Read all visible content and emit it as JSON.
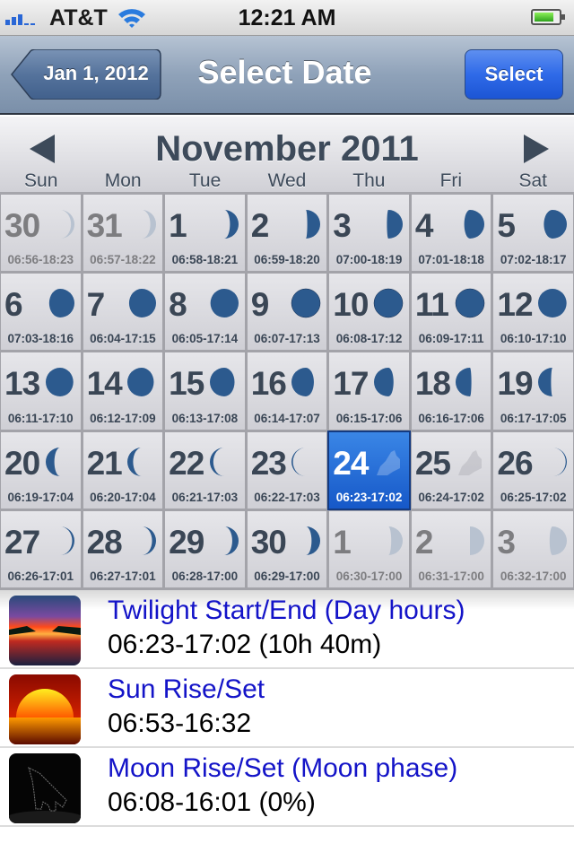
{
  "status_bar": {
    "carrier": "AT&T",
    "time": "12:21 AM",
    "signal_bars": 3,
    "battery_level": 0.7
  },
  "nav": {
    "back_label": "Jan 1, 2012",
    "title": "Select Date",
    "select_label": "Select"
  },
  "calendar": {
    "month_title": "November 2011",
    "weekdays": [
      "Sun",
      "Mon",
      "Tue",
      "Wed",
      "Thu",
      "Fri",
      "Sat"
    ],
    "selected_day": "24",
    "days": [
      {
        "day": "30",
        "times": "06:56-18:23",
        "in_month": false,
        "moon": 0.12,
        "waxing": true
      },
      {
        "day": "31",
        "times": "06:57-18:22",
        "in_month": false,
        "moon": 0.2,
        "waxing": true
      },
      {
        "day": "1",
        "times": "06:58-18:21",
        "in_month": true,
        "moon": 0.3,
        "waxing": true
      },
      {
        "day": "2",
        "times": "06:59-18:20",
        "in_month": true,
        "moon": 0.45,
        "waxing": true
      },
      {
        "day": "3",
        "times": "07:00-18:19",
        "in_month": true,
        "moon": 0.55,
        "waxing": true
      },
      {
        "day": "4",
        "times": "07:01-18:18",
        "in_month": true,
        "moon": 0.7,
        "waxing": true
      },
      {
        "day": "5",
        "times": "07:02-18:17",
        "in_month": true,
        "moon": 0.8,
        "waxing": true
      },
      {
        "day": "6",
        "times": "07:03-18:16",
        "in_month": true,
        "moon": 0.88,
        "waxing": true
      },
      {
        "day": "7",
        "times": "06:04-17:15",
        "in_month": true,
        "moon": 0.94,
        "waxing": true
      },
      {
        "day": "8",
        "times": "06:05-17:14",
        "in_month": true,
        "moon": 0.98,
        "waxing": true
      },
      {
        "day": "9",
        "times": "06:07-17:13",
        "in_month": true,
        "moon": 1.0,
        "waxing": true
      },
      {
        "day": "10",
        "times": "06:08-17:12",
        "in_month": true,
        "moon": 1.0,
        "waxing": true
      },
      {
        "day": "11",
        "times": "06:09-17:11",
        "in_month": true,
        "moon": 1.0,
        "waxing": false
      },
      {
        "day": "12",
        "times": "06:10-17:10",
        "in_month": true,
        "moon": 0.99,
        "waxing": false
      },
      {
        "day": "13",
        "times": "06:11-17:10",
        "in_month": true,
        "moon": 0.96,
        "waxing": false
      },
      {
        "day": "14",
        "times": "06:12-17:09",
        "in_month": true,
        "moon": 0.92,
        "waxing": false
      },
      {
        "day": "15",
        "times": "06:13-17:08",
        "in_month": true,
        "moon": 0.86,
        "waxing": false
      },
      {
        "day": "16",
        "times": "06:14-17:07",
        "in_month": true,
        "moon": 0.78,
        "waxing": false
      },
      {
        "day": "17",
        "times": "06:15-17:06",
        "in_month": true,
        "moon": 0.68,
        "waxing": false
      },
      {
        "day": "18",
        "times": "06:16-17:06",
        "in_month": true,
        "moon": 0.55,
        "waxing": false
      },
      {
        "day": "19",
        "times": "06:17-17:05",
        "in_month": true,
        "moon": 0.45,
        "waxing": false
      },
      {
        "day": "20",
        "times": "06:19-17:04",
        "in_month": true,
        "moon": 0.3,
        "waxing": false
      },
      {
        "day": "21",
        "times": "06:20-17:04",
        "in_month": true,
        "moon": 0.2,
        "waxing": false
      },
      {
        "day": "22",
        "times": "06:21-17:03",
        "in_month": true,
        "moon": 0.12,
        "waxing": false
      },
      {
        "day": "23",
        "times": "06:22-17:03",
        "in_month": true,
        "moon": 0.05,
        "waxing": false
      },
      {
        "day": "24",
        "times": "06:23-17:02",
        "in_month": true,
        "moon": 0.0,
        "waxing": false,
        "icon": "wolf"
      },
      {
        "day": "25",
        "times": "06:24-17:02",
        "in_month": true,
        "moon": 0.0,
        "waxing": true,
        "icon": "wolf"
      },
      {
        "day": "26",
        "times": "06:25-17:02",
        "in_month": true,
        "moon": 0.04,
        "waxing": true
      },
      {
        "day": "27",
        "times": "06:26-17:01",
        "in_month": true,
        "moon": 0.08,
        "waxing": true
      },
      {
        "day": "28",
        "times": "06:27-17:01",
        "in_month": true,
        "moon": 0.14,
        "waxing": true
      },
      {
        "day": "29",
        "times": "06:28-17:00",
        "in_month": true,
        "moon": 0.22,
        "waxing": true
      },
      {
        "day": "30",
        "times": "06:29-17:00",
        "in_month": true,
        "moon": 0.3,
        "waxing": true
      },
      {
        "day": "1",
        "times": "06:30-17:00",
        "in_month": false,
        "moon": 0.4,
        "waxing": true
      },
      {
        "day": "2",
        "times": "06:31-17:00",
        "in_month": false,
        "moon": 0.5,
        "waxing": true
      },
      {
        "day": "3",
        "times": "06:32-17:00",
        "in_month": false,
        "moon": 0.6,
        "waxing": true
      }
    ]
  },
  "details": [
    {
      "title": "Twilight Start/End (Day hours)",
      "value": "06:23-17:02 (10h 40m)",
      "icon": "twilight-icon"
    },
    {
      "title": "Sun Rise/Set",
      "value": "06:53-16:32",
      "icon": "sunset-icon"
    },
    {
      "title": "Moon Rise/Set (Moon phase)",
      "value": "06:08-16:01 (0%)",
      "icon": "howling-wolf-icon"
    }
  ],
  "colors": {
    "accent_blue": "#1658c8",
    "link_blue": "#1414c8",
    "header_text": "#3a4655"
  }
}
